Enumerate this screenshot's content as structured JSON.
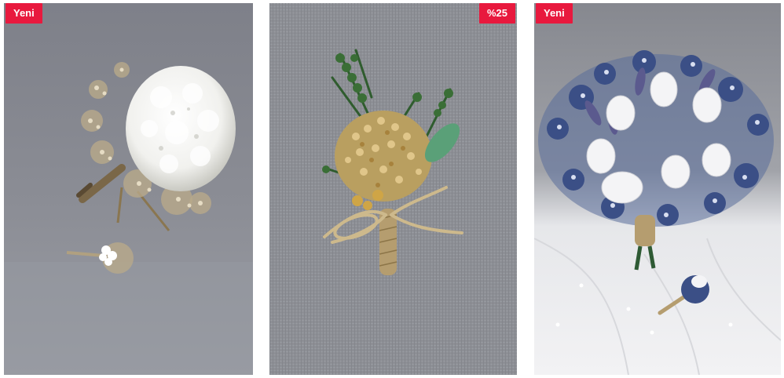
{
  "products": [
    {
      "badge": "Yeni",
      "badge_color": "#e8193e",
      "photo": "white-hydrangea-bouquet-with-boutonniere"
    },
    {
      "badge": "%25",
      "badge_color": "#e8193e",
      "photo": "dried-gypsophila-boutonniere-with-jute-bow"
    },
    {
      "badge": "Yeni",
      "badge_color": "#e8193e",
      "photo": "white-tulip-blue-gypsophila-bouquet-with-veil"
    }
  ]
}
